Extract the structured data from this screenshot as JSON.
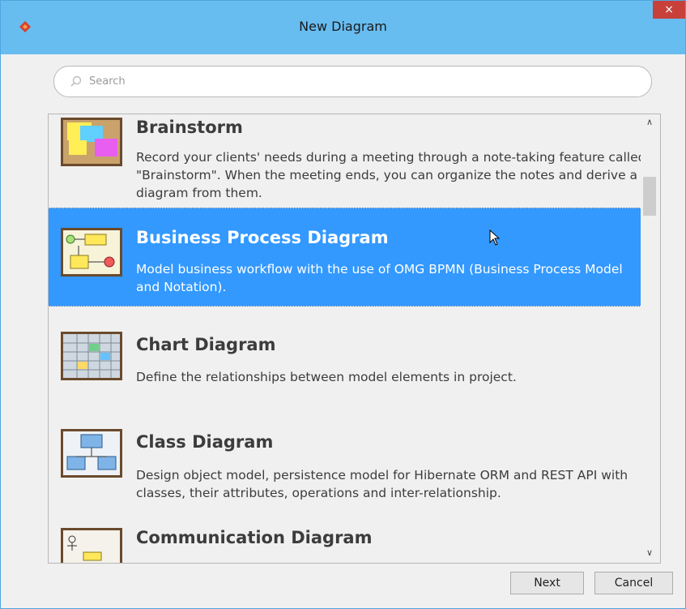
{
  "window": {
    "title": "New Diagram",
    "close_glyph": "×"
  },
  "search": {
    "placeholder": "Search",
    "value": ""
  },
  "list": {
    "items": [
      {
        "title": "Brainstorm",
        "description": "Record your clients' needs during a meeting through a note-taking feature called \"Brainstorm\". When the meeting ends, you can organize the notes and derive a diagram from them.",
        "icon": "brainstorm-icon",
        "selected": false
      },
      {
        "title": "Business Process Diagram",
        "description": "Model business workflow with the use of OMG BPMN (Business Process Model and Notation).",
        "icon": "business-process-diagram-icon",
        "selected": true
      },
      {
        "title": "Chart Diagram",
        "description": "Define the relationships between model elements in project.",
        "icon": "chart-diagram-icon",
        "selected": false
      },
      {
        "title": "Class Diagram",
        "description": "Design object model, persistence model for Hibernate ORM and REST API with classes, their attributes, operations and inter-relationship.",
        "icon": "class-diagram-icon",
        "selected": false
      },
      {
        "title": "Communication Diagram",
        "description": "",
        "icon": "communication-diagram-icon",
        "selected": false
      }
    ]
  },
  "buttons": {
    "next": "Next",
    "cancel": "Cancel"
  },
  "colors": {
    "titlebar": "#68bdf0",
    "selection": "#3399ff",
    "close": "#c7413a"
  }
}
